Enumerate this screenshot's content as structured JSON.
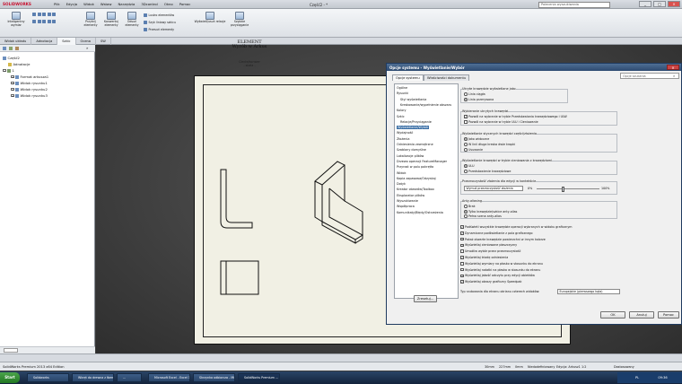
{
  "app": {
    "logo": "SOLIDWORKS",
    "menu": [
      "Plik",
      "Edycja",
      "Widok",
      "Wstaw",
      "Narzędzia",
      "3Dcontrol",
      "Okno",
      "Pomoc"
    ],
    "doc_title": "Część2 - *",
    "search_placeholder": "Polecenia wyszukiwania",
    "window_buttons": [
      "_",
      "□",
      "×"
    ]
  },
  "ribbon": {
    "buttons": [
      "Inteligentny wymiar",
      "Przytnij elementy",
      "Konwertuj elementy",
      "Odsuń elementy",
      "Wyświetl/usuń relacje",
      "Szybkie przyciąganie"
    ],
    "small_items": [
      "Lustro elementów",
      "Szyk liniowy szkicu",
      "Przesuń elementy"
    ],
    "tabs": [
      "Widok układu",
      "Adnotacja",
      "Szkic",
      "Ocena",
      "SW"
    ]
  },
  "tree": {
    "root": "Część2",
    "items": [
      "Adnotacje",
      "1",
      "Format arkusza1",
      "Widok rysunku1",
      "Widok rysunku2",
      "Widok rysunku3"
    ]
  },
  "drawing": {
    "caption_title": "ELEMENT\nWyrób w Arkus",
    "caption_sub": "Ciecie/konwer\n- skala -"
  },
  "dialog": {
    "title": "Opcje systemu - Wyświetlanie/Wybór",
    "close": "×",
    "tabs": [
      "Opcje systemu",
      "Właściwości dokumentu"
    ],
    "search_placeholder": "Opcje szukania",
    "nav": [
      "Ogólne",
      "Rysunki",
      "Styl wyświetlania",
      "Kreskowanie/wypełnienie obszaru",
      "Kolory",
      "Szkic",
      "Relacje/Przyciąganie",
      "Wyświetlanie/Wybór",
      "Wydajność",
      "Złożenia",
      "Odniesienia zewnętrzne",
      "Szablony domyślne",
      "Lokalizacje plików",
      "Drzewo operacji FeatureManager",
      "Przyrost w polu pokrętła",
      "Widok",
      "Kopia zapasowa/Odzyskaj",
      "Dotyk",
      "Kreator otworów/Toolbox",
      "Eksplorator plików",
      "Wyszukiwanie",
      "Współpraca",
      "Komunikaty/Błędy/Ostrzeżenia"
    ],
    "groups": {
      "hidden_edges": {
        "label": "Ukryte krawędzie wyświetlane jako",
        "options": [
          "Linia ciągła",
          "Linia przerywana"
        ]
      },
      "hidden_select": {
        "label": "Wybieranie ukrytych krawędzi",
        "options": [
          "Pozwól na wybranie w trybie Przedstawiania krawędziowego i ULW",
          "Pozwól na wybranie w trybie ULU i Cieniowanie"
        ]
      },
      "tangent": {
        "label": "Wyświetlanie stycznych krawędzi części/złożenia",
        "options": [
          "Jako widoczne",
          "W linii długa kreska dwie kropki",
          "Usuwanie"
        ]
      },
      "shaded": {
        "label": "Wyświetlanie krawędzi w trybie cieniowania z krawędziami",
        "options": [
          "ULU",
          "Przedstawienie krawędziowe"
        ]
      },
      "transparency": {
        "label": "Przezroczystość złożenia dla edycji w kontekście",
        "dropdown": "Wymuś przezroczystość złożenia",
        "min": "0%",
        "max": "100%"
      },
      "anti_alias": {
        "label": "Anty-aliasing",
        "options": [
          "Brak",
          "Tylko krawędzie/szkice anty-alias",
          "Pełna scena anty-alias"
        ]
      }
    },
    "checkboxes": [
      "Podświetl wszystkie krawędzie operacji wybranych w widoku graficznym",
      "Dynamiczne podświetlanie z pola graficznego",
      "Pokaż otwarte krawędzie powierzchni w innym kolorze",
      "Wyświetlaj cieniowane płaszczyzny",
      "Umożliw wybór przez przezroczystość",
      "Wyświetlaj triadę odniesienia",
      "Wyświetlaj wymiary na płasko w stosunku do ekranu",
      "Wyświetlaj notatki na płasko w stosunku do ekranu",
      "Wyświetlaj jakość odczytu przy edycji obiektów",
      "Wyświetlaj obrazy graficzny Speedpak"
    ],
    "checkbox_states": [
      true,
      true,
      true,
      true,
      false,
      true,
      false,
      false,
      true,
      true
    ],
    "projection_label": "Typ rzutowania dla ekranu okrianu czterech widoków:",
    "projection_value": "Europejskie (pierwszego kąta)",
    "reset_button": "Zresetuj...",
    "buttons": [
      "OK",
      "Anuluj",
      "Pomoc"
    ]
  },
  "status": {
    "text": "SolidWorks Premium 2013 x64 Edition",
    "values": [
      "30mm",
      "227mm",
      "0mm",
      "Niedodefiniowany",
      "Edycja: Arkusz1",
      "1:2",
      "Dostosowany"
    ]
  },
  "taskbar": {
    "start": "Start",
    "tasks": [
      "Solidworks",
      "Wkręt do drewna z łbem",
      "...",
      "Microsoft Excel - Excel 1",
      "Skrzynka odbiorcza - Mic...",
      "SolidWorks Premium ..."
    ],
    "lang": "PL",
    "time": "09:36"
  },
  "colors": {
    "accent": "#3a6ea5",
    "dialog_title": "#2d4a70",
    "sheet": "#f1f0e4",
    "graphics_bg": "#3a3a3a"
  }
}
